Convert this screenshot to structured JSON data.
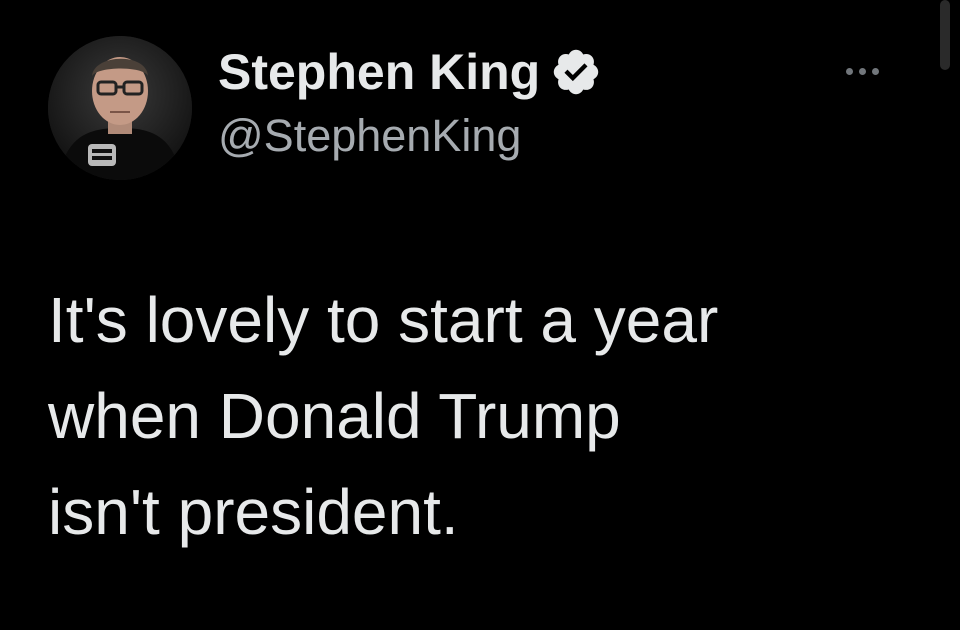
{
  "author": {
    "display_name": "Stephen King",
    "handle": "@StephenKing",
    "verified": true,
    "avatar_icon": "avatar-photo"
  },
  "tweet": {
    "text": "It's lovely to start a year\nwhen Donald Trump\nisn't president."
  },
  "icons": {
    "verified": "verified-badge-icon",
    "more": "more-options-icon"
  },
  "colors": {
    "background": "#000000",
    "primary_text": "#e7e9ea",
    "secondary_text": "#a6abb0",
    "icon_gray": "#71767b"
  }
}
